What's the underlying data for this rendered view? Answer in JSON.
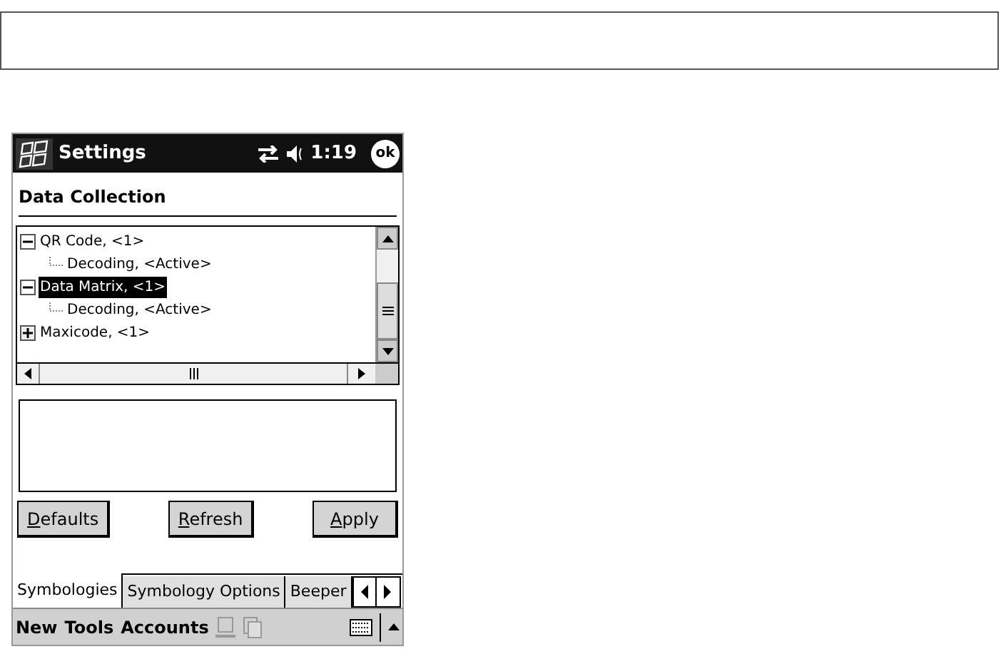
{
  "title_bar": {
    "title": "Settings",
    "time": "1:19",
    "ok": "ok"
  },
  "section_title": "Data Collection",
  "tree": [
    {
      "label": "QR Code, <1>",
      "expanded": true,
      "selected": false,
      "children": [
        {
          "label": "Decoding, <Active>",
          "selected": false
        }
      ]
    },
    {
      "label": "Data Matrix, <1>",
      "expanded": true,
      "selected": true,
      "children": [
        {
          "label": "Decoding, <Active>",
          "selected": false
        }
      ]
    },
    {
      "label": "Maxicode, <1>",
      "expanded": false,
      "selected": false
    }
  ],
  "buttons": [
    "Defaults",
    "Refresh",
    "Apply"
  ],
  "tabs": [
    {
      "label": "Symbologies",
      "selected": true
    },
    {
      "label": "Symbology Options",
      "selected": false
    },
    {
      "label": "Beeper",
      "selected": false
    }
  ],
  "menu_bar": [
    "New",
    "Tools",
    "Accounts"
  ]
}
